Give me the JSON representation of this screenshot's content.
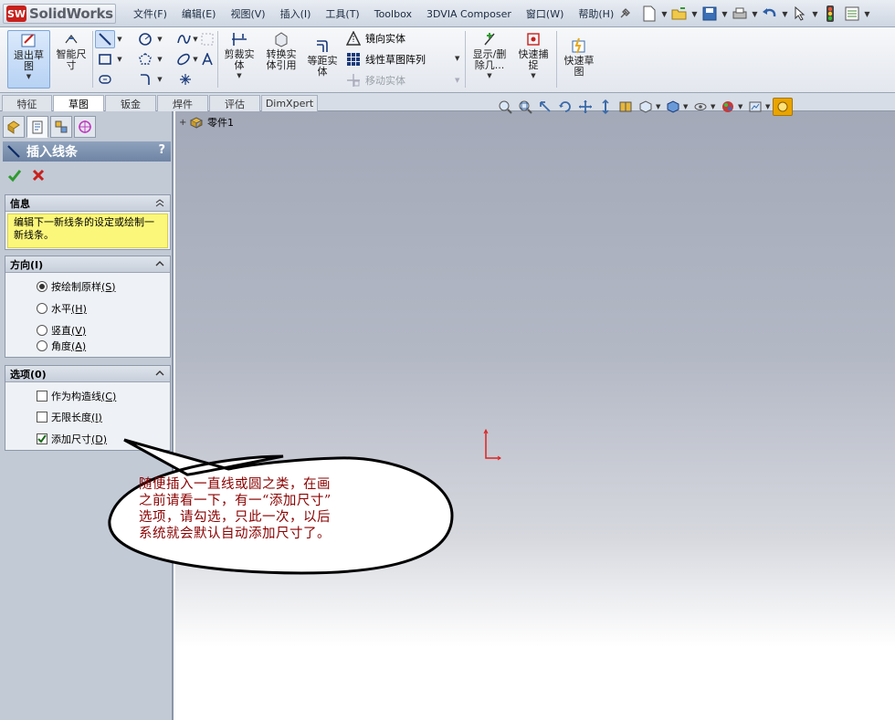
{
  "app": {
    "logo_mark": "SW",
    "logo_text": "SolidWorks"
  },
  "menu": [
    "文件(F)",
    "编辑(E)",
    "视图(V)",
    "插入(I)",
    "工具(T)",
    "Toolbox",
    "3DVIA Composer",
    "窗口(W)",
    "帮助(H)"
  ],
  "toolbar": {
    "exit_sketch": "退出草图",
    "smart_dim": "智能尺寸",
    "trim": "剪裁实体",
    "convert": "转换实体引用",
    "offset": "等距实体",
    "mirror": "镜向实体",
    "linear_pattern": "线性草图阵列",
    "move": "移动实体",
    "show_delete": "显示/删除几...",
    "quick_snap": "快速捕捉",
    "rapid_sketch": "快速草图"
  },
  "tabs": [
    "特征",
    "草图",
    "钣金",
    "焊件",
    "评估",
    "DimXpert"
  ],
  "active_tab": "草图",
  "property_manager": {
    "title": "插入线条",
    "help": "?",
    "info_header": "信息",
    "info_text": "编辑下一新线条的设定或绘制一新线条。",
    "direction_header": "方向(I)",
    "direction_options": [
      {
        "label": "按绘制原样",
        "key": "(S)",
        "selected": true
      },
      {
        "label": "水平",
        "key": "(H)",
        "selected": false
      },
      {
        "label": "竖直",
        "key": "(V)",
        "selected": false
      },
      {
        "label": "角度",
        "key": "(A)",
        "selected": false
      }
    ],
    "options_header": "选项(0)",
    "options": [
      {
        "label": "作为构造线",
        "key": "(C)",
        "checked": false
      },
      {
        "label": "无限长度",
        "key": "(I)",
        "checked": false
      },
      {
        "label": "添加尺寸",
        "key": "(D)",
        "checked": true
      }
    ]
  },
  "tree": {
    "root": "零件1"
  },
  "callout": {
    "lines": [
      "随便插入一直线或圆之类，在画",
      "之前请看一下，有一“添加尺寸”",
      "选项，请勾选，只此一次，以后",
      "系统就会默认自动添加尺寸了。"
    ]
  },
  "colors": {
    "accent": "#c8201c",
    "callout_text": "#8b0000",
    "info_bg": "#fbf77b"
  }
}
